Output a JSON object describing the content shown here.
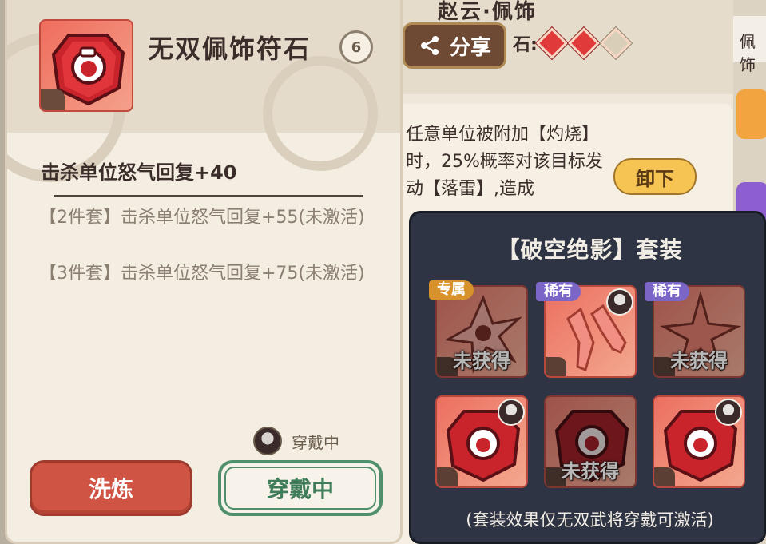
{
  "background_panel": {
    "title": "赵云·佩饰",
    "share_label": "分享",
    "gem_prefix": "石:",
    "description": "任意单位被附加【灼烧】时，25%概率对该目标发动【落雷】,造成",
    "unequip_label": "卸下",
    "side_tab_label": "佩饰"
  },
  "item": {
    "name": "无双佩饰符石",
    "lock_level": "6",
    "main_stat": "击杀单位怒气回复+40",
    "set_bonus_2": "【2件套】击杀单位怒气回复+55(未激活)",
    "set_bonus_3": "【3件套】击杀单位怒气回复+75(未激活)",
    "wearer_status": "穿戴中",
    "refine_label": "洗炼",
    "wearing_label": "穿戴中"
  },
  "set_popup": {
    "title": "【破空绝影】套装",
    "pieces": [
      {
        "tag": "专属",
        "status": "未获得"
      },
      {
        "tag": "稀有",
        "status": ""
      },
      {
        "tag": "稀有",
        "status": "未获得"
      },
      {
        "tag": "",
        "status": ""
      },
      {
        "tag": "",
        "status": "未获得"
      },
      {
        "tag": "",
        "status": ""
      }
    ],
    "note": "(套装效果仅无双武将穿戴可激活)"
  },
  "colors": {
    "refine_button": "#cf5444",
    "wearing_border": "#4f8f6c",
    "unequip_button": "#f6c453",
    "popup_bg": "#2e3443",
    "gem_red": "#e03a3a"
  }
}
